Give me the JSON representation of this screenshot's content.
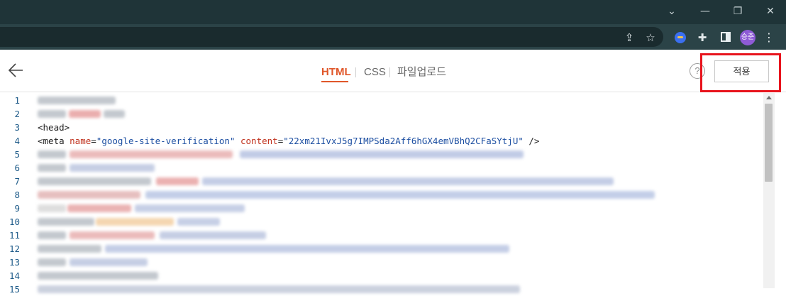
{
  "browser": {
    "window_controls": {
      "minimize": "—",
      "restore": "❐",
      "close": "✕",
      "chevron": "⌄"
    },
    "toolbar_icons": [
      "share-icon",
      "star-icon",
      "extension-icon",
      "puzzle-icon",
      "side-panel-icon",
      "avatar",
      "more-icon"
    ],
    "share_glyph": "⇪",
    "star_glyph": "☆",
    "puzzle_glyph": "✚",
    "avatar_text": "승준",
    "more_glyph": "⋮"
  },
  "editor": {
    "back_icon": "arrow-left-icon",
    "tabs": [
      {
        "label": "HTML",
        "active": true
      },
      {
        "label": "CSS",
        "active": false
      },
      {
        "label": "파일업로드",
        "active": false
      }
    ],
    "help_label": "?",
    "apply_label": "적용",
    "accent_color": "#e0572a",
    "highlight_color": "#e8141d"
  },
  "code": {
    "line_numbers": [
      "1",
      "2",
      "3",
      "4",
      "5",
      "6",
      "7",
      "8",
      "9",
      "10",
      "11",
      "12",
      "13",
      "14",
      "15"
    ],
    "line3": "<head>",
    "line4": {
      "open": "<meta ",
      "attr1": "name",
      "eq1": "=",
      "val1": "\"google-site-verification\"",
      "space": " ",
      "attr2": "content",
      "eq2": "=",
      "val2": "\"22xm21IvxJ5g7IMPSda2Aff6hGX4emVBhQ2CFaSYtjU\"",
      "close": " />"
    }
  }
}
